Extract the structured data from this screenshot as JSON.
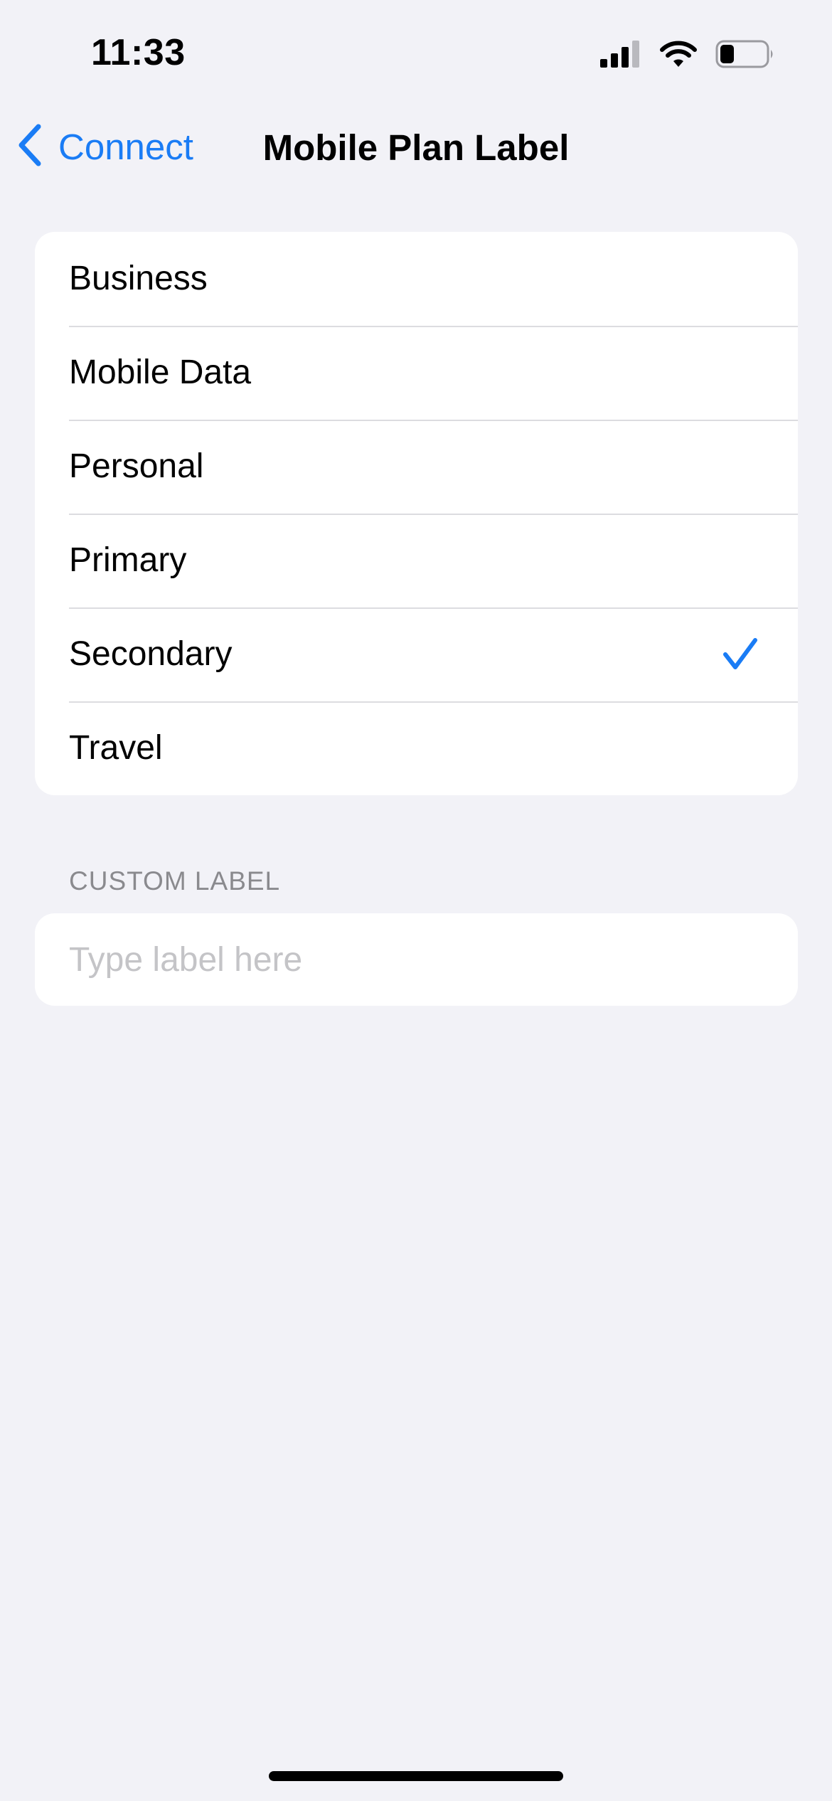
{
  "status_bar": {
    "time": "11:33",
    "battery_level": 0.3
  },
  "nav": {
    "back_label": "Connect",
    "title": "Mobile Plan Label"
  },
  "options": [
    {
      "label": "Business",
      "selected": false
    },
    {
      "label": "Mobile Data",
      "selected": false
    },
    {
      "label": "Personal",
      "selected": false
    },
    {
      "label": "Primary",
      "selected": false
    },
    {
      "label": "Secondary",
      "selected": true
    },
    {
      "label": "Travel",
      "selected": false
    }
  ],
  "custom_label": {
    "header": "CUSTOM LABEL",
    "placeholder": "Type label here",
    "value": ""
  },
  "colors": {
    "accent": "#1a7cf5",
    "background": "#f2f2f7",
    "card": "#ffffff"
  },
  "icons": [
    "signal-icon",
    "wifi-icon",
    "battery-icon",
    "chevron-left-icon",
    "checkmark-icon"
  ]
}
